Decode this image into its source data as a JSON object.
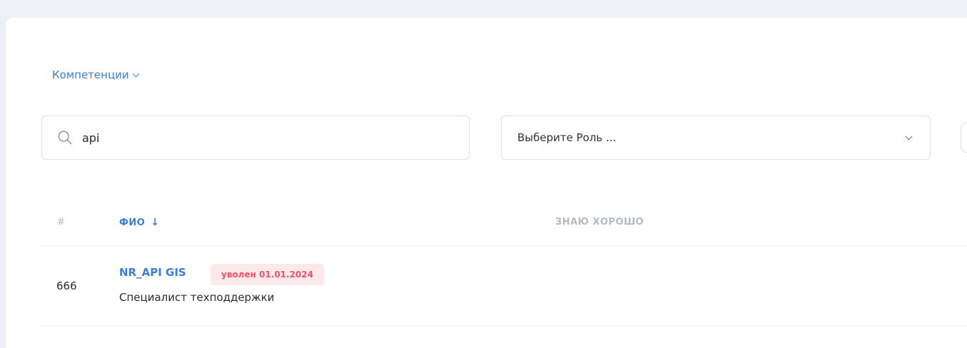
{
  "filters": {
    "competencies_label": "Компетенции",
    "search_value": "api",
    "role_placeholder": "Выберите Роль ..."
  },
  "table": {
    "headers": {
      "num": "#",
      "fio": "ФИО",
      "sort_arrow": "↓",
      "know_well": "ЗНАЮ ХОРОШО"
    },
    "rows": [
      {
        "num": "666",
        "name": "NR_API GIS",
        "badge": "уволен 01.01.2024",
        "role": "Специалист техподдержки"
      }
    ]
  },
  "colors": {
    "accent": "#3b7ddd",
    "badge_bg": "#fde8ea",
    "badge_text": "#f0506e",
    "page_bg": "#eef0f8"
  },
  "icons": {
    "search": "search-icon",
    "competencies_chevron": "chevron-down-icon",
    "role_chevron": "chevron-down-icon",
    "sort": "arrow-down-icon"
  }
}
